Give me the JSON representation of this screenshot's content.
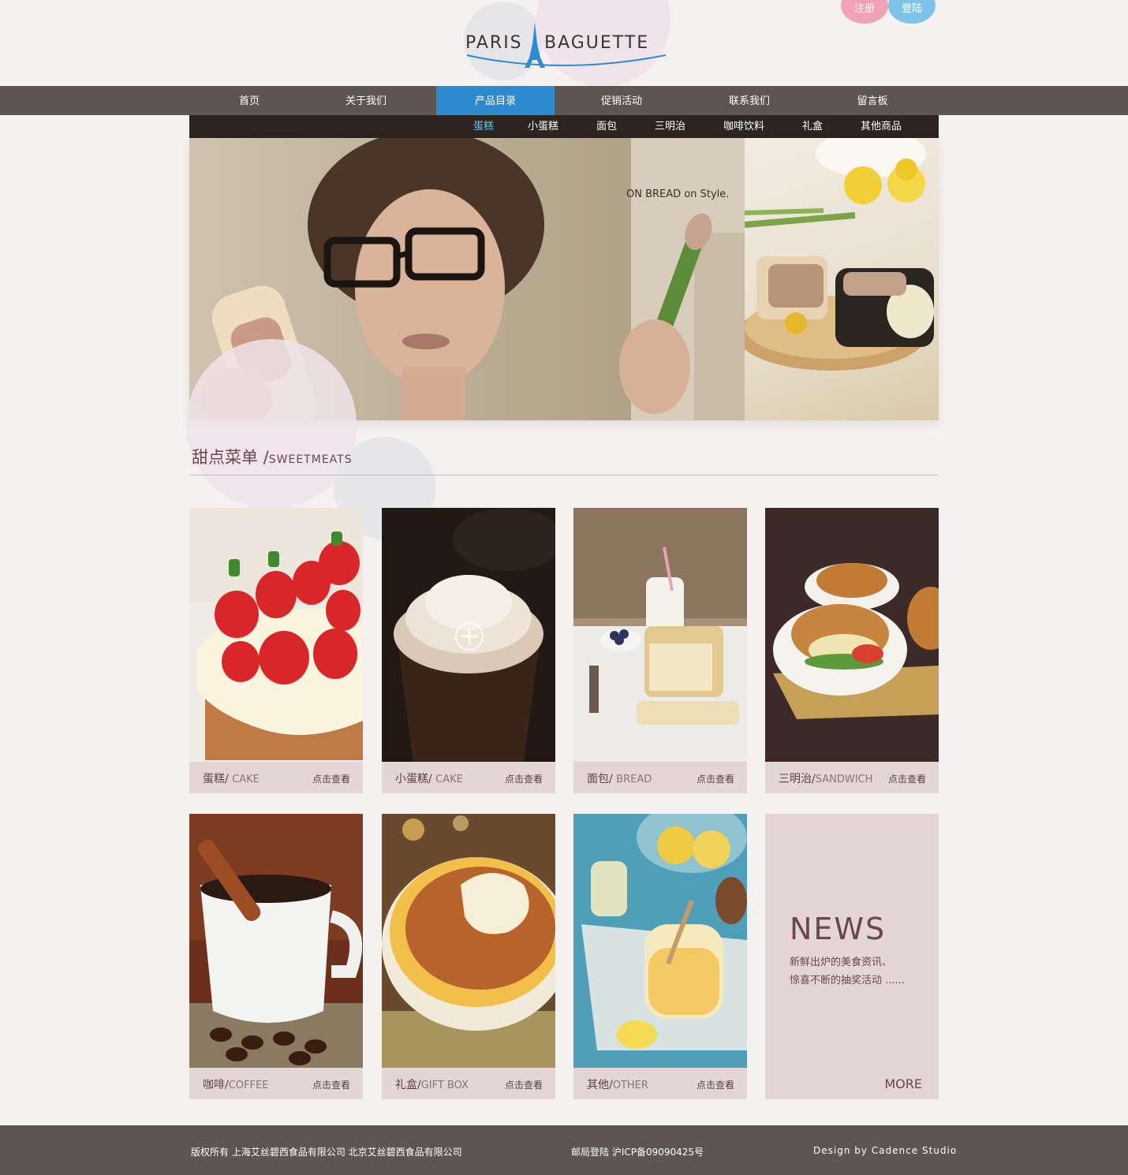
{
  "header": {
    "logo_left": "PARIS",
    "logo_right": "BAGUETTE",
    "register": "注册",
    "login": "登陆"
  },
  "nav": {
    "items": [
      "首页",
      "关于我们",
      "产品目录",
      "促销活动",
      "联系我们",
      "留言板"
    ],
    "active_index": 2
  },
  "subnav": {
    "items": [
      "蛋糕",
      "小蛋糕",
      "面包",
      "三明治",
      "咖啡饮料",
      "礼盒",
      "其他商品"
    ],
    "active_index": 0
  },
  "banner": {
    "tagline": "ON BREAD on Style."
  },
  "section": {
    "title_cn": "甜点菜单 /",
    "title_en": "SWEETMEATS"
  },
  "cards": [
    {
      "cn": "蛋糕/ ",
      "en": "CAKE",
      "more": "点击查看"
    },
    {
      "cn": "小蛋糕/ ",
      "en": "CAKE",
      "more": "点击查看"
    },
    {
      "cn": "面包/ ",
      "en": "BREAD",
      "more": "点击查看"
    },
    {
      "cn": "三明治/",
      "en": "SANDWICH",
      "more": "点击查看"
    },
    {
      "cn": "咖啡/",
      "en": "COFFEE",
      "more": "点击查看"
    },
    {
      "cn": "礼盒/",
      "en": "GIFT BOX",
      "more": "点击查看"
    },
    {
      "cn": "其他/",
      "en": "OTHER",
      "more": "点击查看"
    }
  ],
  "news": {
    "title": "NEWS",
    "line1": "新鲜出炉的美食资讯、",
    "line2": "惊喜不断的抽奖活动 ......",
    "more": "MORE"
  },
  "footer": {
    "copyright": "版权所有    上海艾丝碧西食品有限公司 北京艾丝碧西食品有限公司",
    "mail": "邮局登陆    沪ICP备09090425号",
    "design": "Design by Cadence Studio"
  },
  "colors": {
    "nav_bg": "#5e5551",
    "nav_active": "#2e8bd0",
    "subnav_bg": "#2d2422",
    "subnav_active": "#6ec2f0",
    "caption_bg": "#e4d5d7",
    "register_badge": "#efa3b4",
    "login_badge": "#7fc3ea"
  }
}
